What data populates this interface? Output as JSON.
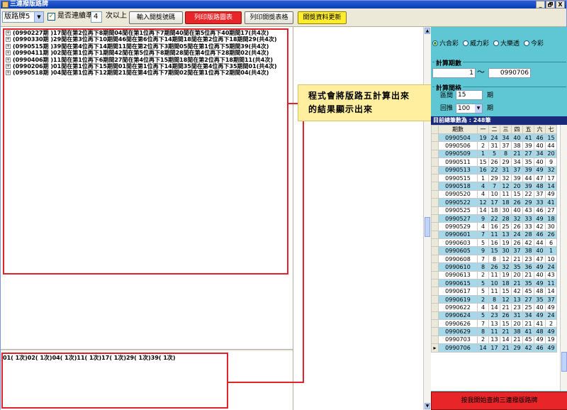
{
  "window": {
    "title": "三連撥版路牌",
    "buttons": [
      "_",
      "🗗",
      "X"
    ]
  },
  "toolbar": {
    "pattern_select": "版路牌5",
    "check_label": "是否連續準",
    "streak_value": "4",
    "streak_suffix": "次以上",
    "btn_input": "輸入開獎號碼",
    "btn_print_chart": "列印版路圖表",
    "btn_print_table": "列印開獎表格",
    "btn_update": "開獎資料更新"
  },
  "tree": {
    "rows": [
      "(0990227期 )17閒在第2位再下8期間04閒在第1位再下7期間40閒在第5位再下40期間17(共4次)",
      "(0990330期 )29閒在第3位再下10期間46閒在第6位再下14期間18閒在第2位再下18期間29(共4次)",
      "(0990515期 )39閒在第4位再下14期間11閒在第2位再下3期間05閒在第1位再下5期間39(共4次)",
      "(0990411期 )02閒在第1位再下1期間42閒在第5位再下8期間28閒在第4位再下28期間02(共4次)",
      "(0990406期 )11閒在第1位再下6期間27閒在第4位再下15期間18閒在第2位再下18期間11(共4次)",
      "(0990206期 )01閒在第1位再下15期間01閒在第1位再下14期間35閒在第4位再下35期間01(共4次)",
      "(0990518期 )04閒在第1位再下12期間21閒在第4位再下7期間02閒在第1位再下2期間04(共4次)"
    ]
  },
  "bottom": {
    "text": "01(   1次)02(   1次)04(   1次)11(   1次)17(   1次)29(   1次)39(   1次)"
  },
  "callout": {
    "line1": "程式會將版路五計算出來",
    "line2": "的結果顯示出來"
  },
  "right": {
    "radios": [
      {
        "label": "六合彩",
        "selected": true
      },
      {
        "label": "威力彩",
        "selected": false
      },
      {
        "label": "大樂透",
        "selected": false
      },
      {
        "label": "今彩",
        "selected": false
      }
    ],
    "calc_period_label": "計算期數",
    "period_from": "1",
    "period_tilde": "〜",
    "period_to": "0990706",
    "calc_gap_label": "計算間格",
    "gap_label": "區間",
    "gap_value": "15",
    "gap_unit": "期",
    "back_label": "回推",
    "back_value": "100",
    "back_unit": "期",
    "total_label": "目前總筆數為 : 248筆",
    "grid_headers": [
      "期數",
      "一",
      "二",
      "三",
      "四",
      "五",
      "六",
      "七"
    ],
    "grid_rows": [
      [
        "0990504",
        "19",
        "24",
        "34",
        "40",
        "41",
        "46",
        "15"
      ],
      [
        "0990506",
        "2",
        "31",
        "37",
        "38",
        "39",
        "40",
        "44"
      ],
      [
        "0990509",
        "1",
        "5",
        "8",
        "21",
        "27",
        "34",
        "20"
      ],
      [
        "0990511",
        "15",
        "26",
        "29",
        "34",
        "35",
        "40",
        "9"
      ],
      [
        "0990513",
        "16",
        "22",
        "31",
        "37",
        "39",
        "49",
        "32"
      ],
      [
        "0990515",
        "1",
        "29",
        "32",
        "39",
        "44",
        "47",
        "17"
      ],
      [
        "0990518",
        "4",
        "7",
        "12",
        "20",
        "39",
        "48",
        "14"
      ],
      [
        "0990520",
        "4",
        "10",
        "11",
        "15",
        "22",
        "37",
        "49"
      ],
      [
        "0990522",
        "12",
        "17",
        "18",
        "26",
        "29",
        "33",
        "41"
      ],
      [
        "0990525",
        "14",
        "18",
        "30",
        "40",
        "43",
        "46",
        "27"
      ],
      [
        "0990527",
        "9",
        "22",
        "28",
        "32",
        "33",
        "49",
        "18"
      ],
      [
        "0990529",
        "4",
        "16",
        "25",
        "26",
        "33",
        "42",
        "30"
      ],
      [
        "0990601",
        "7",
        "11",
        "13",
        "24",
        "28",
        "46",
        "26"
      ],
      [
        "0990603",
        "5",
        "16",
        "19",
        "26",
        "42",
        "44",
        "6"
      ],
      [
        "0990605",
        "9",
        "15",
        "30",
        "37",
        "38",
        "40",
        "1"
      ],
      [
        "0990608",
        "7",
        "8",
        "12",
        "21",
        "23",
        "47",
        "10"
      ],
      [
        "0990610",
        "8",
        "26",
        "32",
        "35",
        "36",
        "49",
        "24"
      ],
      [
        "0990613",
        "2",
        "11",
        "19",
        "20",
        "21",
        "40",
        "43"
      ],
      [
        "0990615",
        "5",
        "10",
        "18",
        "21",
        "35",
        "49",
        "11"
      ],
      [
        "0990617",
        "5",
        "11",
        "15",
        "42",
        "45",
        "48",
        "14"
      ],
      [
        "0990619",
        "2",
        "8",
        "12",
        "13",
        "27",
        "35",
        "37"
      ],
      [
        "0990622",
        "4",
        "14",
        "21",
        "23",
        "25",
        "40",
        "49"
      ],
      [
        "0990624",
        "5",
        "23",
        "26",
        "31",
        "34",
        "49",
        "24"
      ],
      [
        "0990626",
        "7",
        "13",
        "15",
        "20",
        "21",
        "41",
        "2"
      ],
      [
        "0990629",
        "8",
        "11",
        "21",
        "38",
        "41",
        "48",
        "49"
      ],
      [
        "0990703",
        "2",
        "13",
        "14",
        "21",
        "45",
        "49",
        "19"
      ],
      [
        "0990706",
        "14",
        "17",
        "21",
        "29",
        "42",
        "46",
        "49"
      ]
    ],
    "row_marker": "▸",
    "big_button": "按我開始查詢三連撥版路牌"
  }
}
